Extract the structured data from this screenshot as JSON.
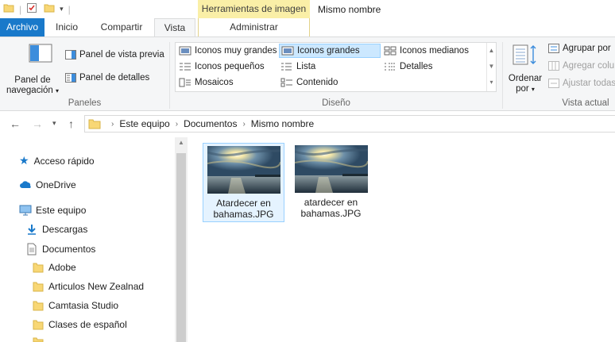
{
  "titlebar": {
    "context_tab_group": "Herramientas de imagen",
    "window_title": "Mismo nombre"
  },
  "tabs": {
    "file": "Archivo",
    "home": "Inicio",
    "share": "Compartir",
    "view": "Vista",
    "manage": "Administrar"
  },
  "ribbon": {
    "panes": {
      "nav_pane_line1": "Panel de",
      "nav_pane_line2": "navegación",
      "preview_pane": "Panel de vista previa",
      "details_pane": "Panel de detalles",
      "group_label": "Paneles"
    },
    "layout": {
      "items": {
        "extra_large": "Iconos muy grandes",
        "large": "Iconos grandes",
        "medium": "Iconos medianos",
        "small": "Iconos pequeños",
        "list": "Lista",
        "details": "Detalles",
        "tiles": "Mosaicos",
        "content": "Contenido"
      },
      "selected": "Iconos grandes",
      "group_label": "Diseño"
    },
    "current_view": {
      "sort_line1": "Ordenar",
      "sort_line2": "por",
      "group_by": "Agrupar por",
      "add_columns": "Agregar colu",
      "size_columns": "Ajustar todas",
      "group_label": "Vista actual"
    }
  },
  "address": {
    "crumbs": [
      "Este equipo",
      "Documentos",
      "Mismo nombre"
    ]
  },
  "sidebar": {
    "quick_access": "Acceso rápido",
    "onedrive": "OneDrive",
    "this_pc": "Este equipo",
    "downloads": "Descargas",
    "documents": "Documentos",
    "folders": [
      "Adobe",
      "Articulos New Zealnad",
      "Camtasia Studio",
      "Clases de español"
    ]
  },
  "files": [
    {
      "name_line1": "Atardecer en",
      "name_line2": "bahamas.JPG",
      "selected": true
    },
    {
      "name_line1": "atardecer en",
      "name_line2": "bahamas.JPG",
      "selected": false
    }
  ],
  "colors": {
    "accent": "#1979ca",
    "context_tab": "#faefa7",
    "selection_bg": "#cce8ff",
    "folder": "#f8d775"
  }
}
